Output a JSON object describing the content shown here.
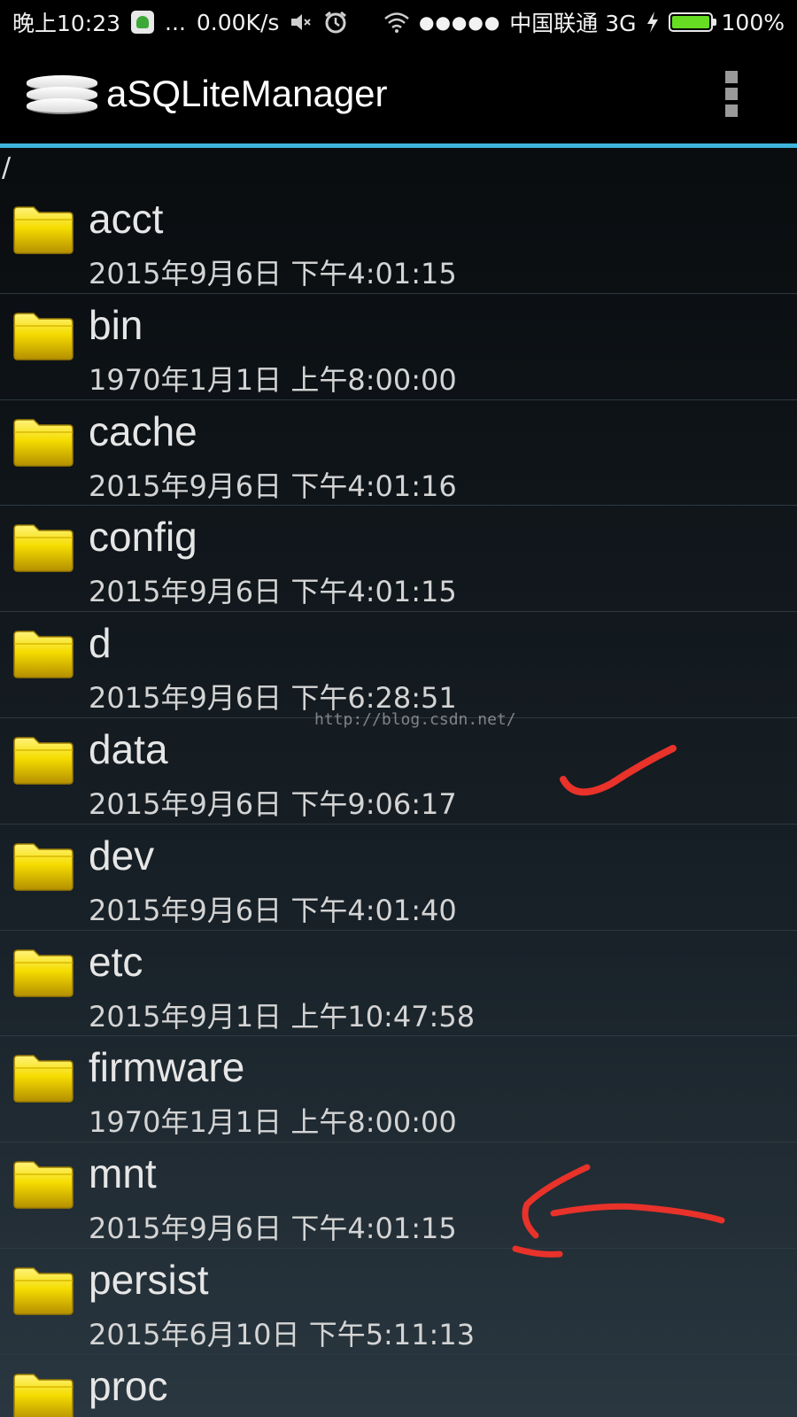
{
  "status_bar": {
    "time": "晚上10:23",
    "more": "...",
    "net_speed": "0.00K/s",
    "dots": "●●●●●",
    "carrier": "中国联通 3G",
    "battery": "100%",
    "battery_level": 1.0
  },
  "action_bar": {
    "app_icon": "database-icon",
    "title": "aSQLiteManager",
    "overflow_icon": "overflow-menu-icon"
  },
  "path": "/",
  "files": [
    {
      "name": "acct",
      "date": "2015年9月6日 下午4:01:15"
    },
    {
      "name": "bin",
      "date": "1970年1月1日 上午8:00:00"
    },
    {
      "name": "cache",
      "date": "2015年9月6日 下午4:01:16"
    },
    {
      "name": "config",
      "date": "2015年9月6日 下午4:01:15"
    },
    {
      "name": "d",
      "date": "2015年9月6日 下午6:28:51"
    },
    {
      "name": "data",
      "date": "2015年9月6日 下午9:06:17"
    },
    {
      "name": "dev",
      "date": "2015年9月6日 下午4:01:40"
    },
    {
      "name": "etc",
      "date": "2015年9月1日 上午10:47:58"
    },
    {
      "name": "firmware",
      "date": "1970年1月1日 上午8:00:00"
    },
    {
      "name": "mnt",
      "date": "2015年9月6日 下午4:01:15"
    },
    {
      "name": "persist",
      "date": "2015年6月10日 下午5:11:13"
    },
    {
      "name": "proc",
      "date": ""
    }
  ],
  "watermark": "http://blog.csdn.net/",
  "colors": {
    "accent_line": "#3fb3dc",
    "folder": "#f2d500",
    "annotation": "#e8322a"
  }
}
